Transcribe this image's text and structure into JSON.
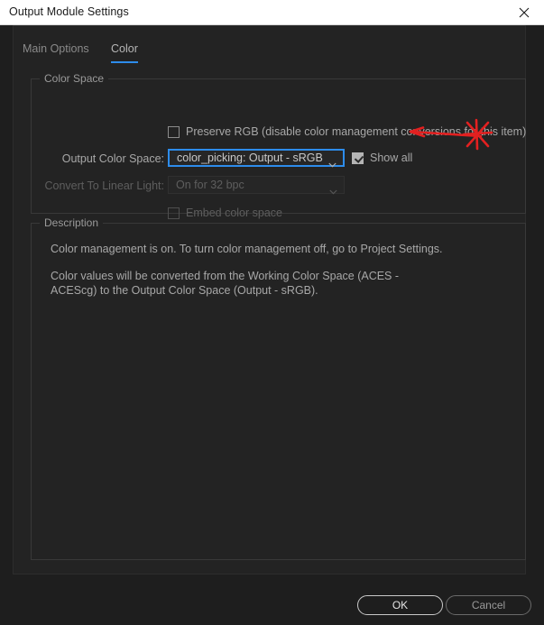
{
  "window": {
    "title": "Output Module Settings",
    "close_icon": "close-icon"
  },
  "tabs": [
    {
      "label": "Main Options",
      "active": false
    },
    {
      "label": "Color",
      "active": true
    }
  ],
  "color_space_group": {
    "legend": "Color Space",
    "preserve_rgb": {
      "label": "Preserve RGB (disable color management conversions for this item)",
      "checked": false,
      "enabled": true
    },
    "output_color_space": {
      "label": "Output Color Space:",
      "value": "color_picking: Output - sRGB",
      "enabled": true,
      "focused": true,
      "arrow_icon": "chevron-down-icon"
    },
    "show_all": {
      "label": "Show all",
      "checked": true,
      "enabled": true
    },
    "convert_to_linear_light": {
      "label": "Convert To Linear Light:",
      "value": "On for 32 bpc",
      "enabled": false,
      "arrow_icon": "chevron-down-icon"
    },
    "embed_color_space": {
      "label": "Embed color space",
      "checked": false,
      "enabled": false
    }
  },
  "description_group": {
    "legend": "Description",
    "paragraph_1": "Color management is on. To turn color management off, go to Project Settings.",
    "paragraph_2": "Color values will be converted from the Working Color Space (ACES - ACEScg) to the Output Color Space (Output - sRGB)."
  },
  "footer": {
    "ok_label": "OK",
    "cancel_label": "Cancel"
  },
  "annotation": {
    "type": "red-arrow-with-starburst",
    "color": "#e32020",
    "points_to": "show-all-checkbox"
  },
  "colors": {
    "accent_blue": "#2d8ceb",
    "titlebar_bg": "#ffffff",
    "dialog_bg": "#1e1e1e",
    "panel_bg": "#232323",
    "annotation_red": "#e32020"
  }
}
